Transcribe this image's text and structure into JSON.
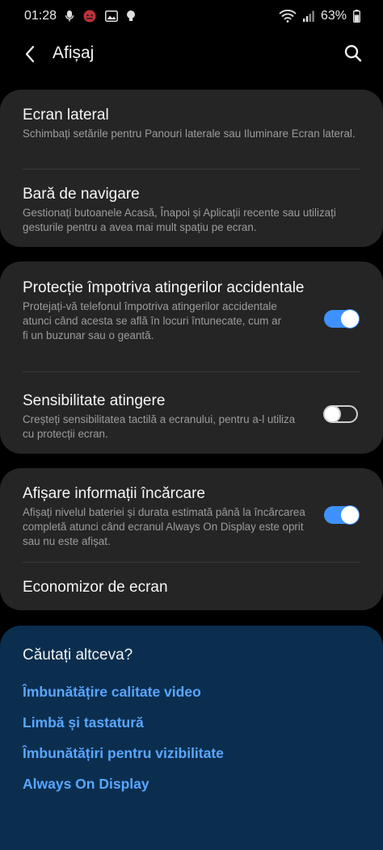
{
  "status_bar": {
    "time": "01:28",
    "battery": "63%"
  },
  "header": {
    "title": "Afișaj"
  },
  "group1": {
    "items": [
      {
        "title": "Ecran lateral",
        "subtitle": "Schimbați setările pentru Panouri laterale sau Iluminare Ecran lateral."
      },
      {
        "title": "Bară de navigare",
        "subtitle": "Gestionați butoanele Acasă, Înapoi și Aplicații recente sau utilizați gesturile pentru a avea mai mult spațiu pe ecran."
      }
    ]
  },
  "group2": {
    "items": [
      {
        "title": "Protecție împotriva atingerilor accidentale",
        "subtitle": "Protejați-vă telefonul împotriva atingerilor accidentale atunci când acesta se află în locuri întunecate, cum ar fi un buzunar sau o geantă.",
        "toggle": "on"
      },
      {
        "title": "Sensibilitate atingere",
        "subtitle": "Creșteți sensibilitatea tactilă a ecranului, pentru a-l utiliza cu protecții ecran.",
        "toggle": "off"
      }
    ]
  },
  "group3": {
    "items": [
      {
        "title": "Afișare informații încărcare",
        "subtitle": "Afișați nivelul bateriei și durata estimată până la încărcarea completă atunci când ecranul Always On Display este oprit sau nu este afișat.",
        "toggle": "on"
      },
      {
        "title": "Economizor de ecran"
      }
    ]
  },
  "suggestions": {
    "title": "Căutați altceva?",
    "links": [
      "Îmbunătățire calitate video",
      "Limbă și tastatură",
      "Îmbunătățiri pentru vizibilitate",
      "Always On Display"
    ]
  },
  "colors": {
    "accent": "#3e91ff",
    "link": "#5aa6ff",
    "card": "#252525",
    "suggest_bg": "#0b2e4f"
  }
}
